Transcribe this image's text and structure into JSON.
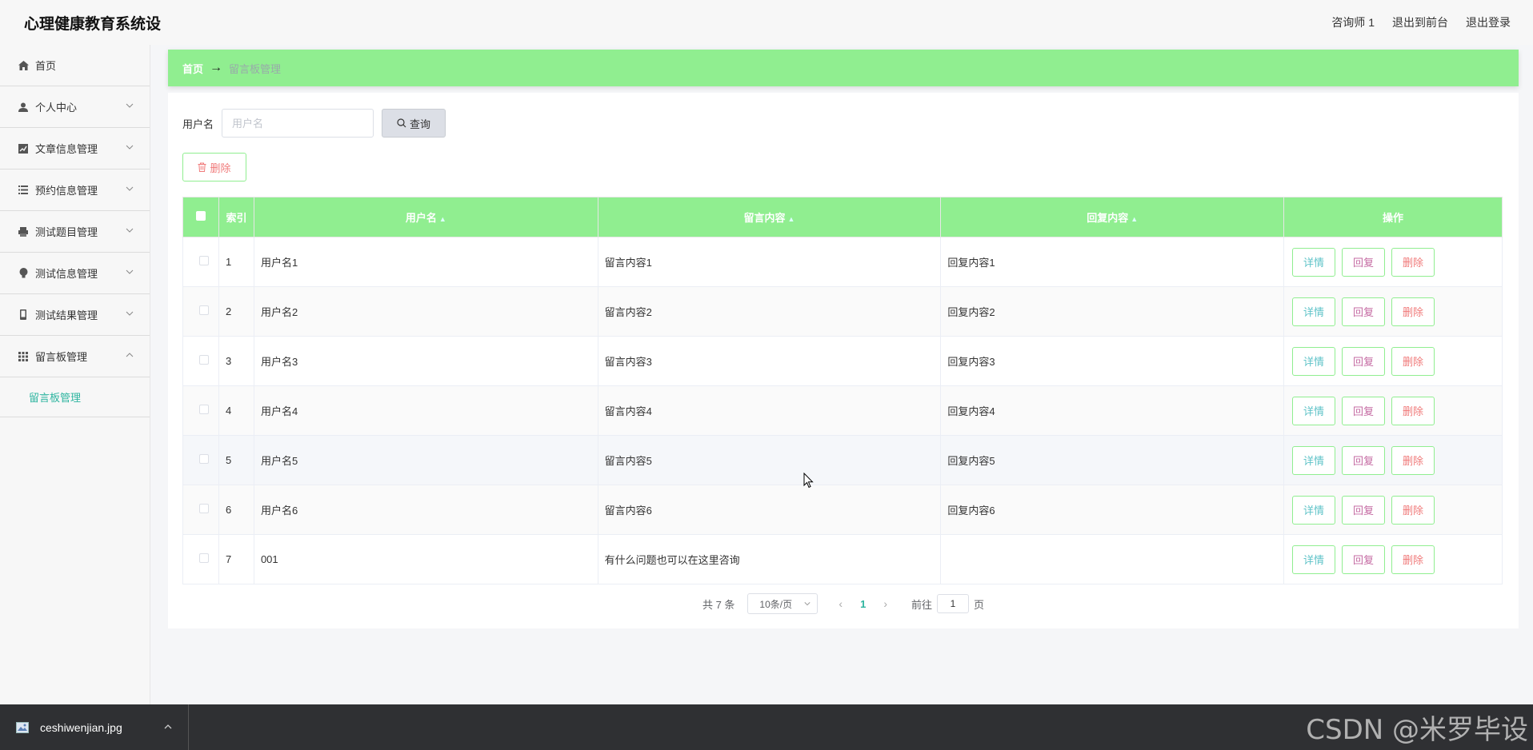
{
  "header": {
    "title": "心理健康教育系统设",
    "user": "咨询师 1",
    "front_link": "退出到前台",
    "logout": "退出登录"
  },
  "sidebar": {
    "items": [
      {
        "label": "首页",
        "icon": "home-icon"
      },
      {
        "label": "个人中心",
        "icon": "user-icon"
      },
      {
        "label": "文章信息管理",
        "icon": "chart-icon"
      },
      {
        "label": "预约信息管理",
        "icon": "list-icon"
      },
      {
        "label": "测试题目管理",
        "icon": "printer-icon"
      },
      {
        "label": "测试信息管理",
        "icon": "bulb-icon"
      },
      {
        "label": "测试结果管理",
        "icon": "phone-icon"
      },
      {
        "label": "留言板管理",
        "icon": "grid-icon"
      }
    ],
    "active_sub": "留言板管理"
  },
  "breadcrumb": {
    "home": "首页",
    "arrow": "→",
    "current": "留言板管理"
  },
  "search": {
    "label": "用户名",
    "placeholder": "用户名",
    "button": "查询"
  },
  "bulk_delete": "删除",
  "table": {
    "columns": [
      "索引",
      "用户名",
      "留言内容",
      "回复内容",
      "操作"
    ],
    "rows": [
      {
        "index": "1",
        "username": "用户名1",
        "message": "留言内容1",
        "reply": "回复内容1"
      },
      {
        "index": "2",
        "username": "用户名2",
        "message": "留言内容2",
        "reply": "回复内容2"
      },
      {
        "index": "3",
        "username": "用户名3",
        "message": "留言内容3",
        "reply": "回复内容3"
      },
      {
        "index": "4",
        "username": "用户名4",
        "message": "留言内容4",
        "reply": "回复内容4"
      },
      {
        "index": "5",
        "username": "用户名5",
        "message": "留言内容5",
        "reply": "回复内容5"
      },
      {
        "index": "6",
        "username": "用户名6",
        "message": "留言内容6",
        "reply": "回复内容6"
      },
      {
        "index": "7",
        "username": "001",
        "message": "有什么问题也可以在这里咨询",
        "reply": ""
      }
    ],
    "actions": {
      "detail": "详情",
      "reply": "回复",
      "delete": "删除"
    }
  },
  "pagination": {
    "total": "共 7 条",
    "page_size": "10条/页",
    "current_page": "1",
    "goto_label": "前往",
    "goto_value": "1",
    "goto_suffix": "页"
  },
  "taskbar": {
    "download_name": "ceshiwenjian.jpg",
    "watermark": "CSDN @米罗毕设"
  },
  "colors": {
    "accent_green": "#90ee90",
    "teal": "#2fb5a0",
    "danger": "#f07a7a",
    "reply_pink": "#c56ba3"
  }
}
